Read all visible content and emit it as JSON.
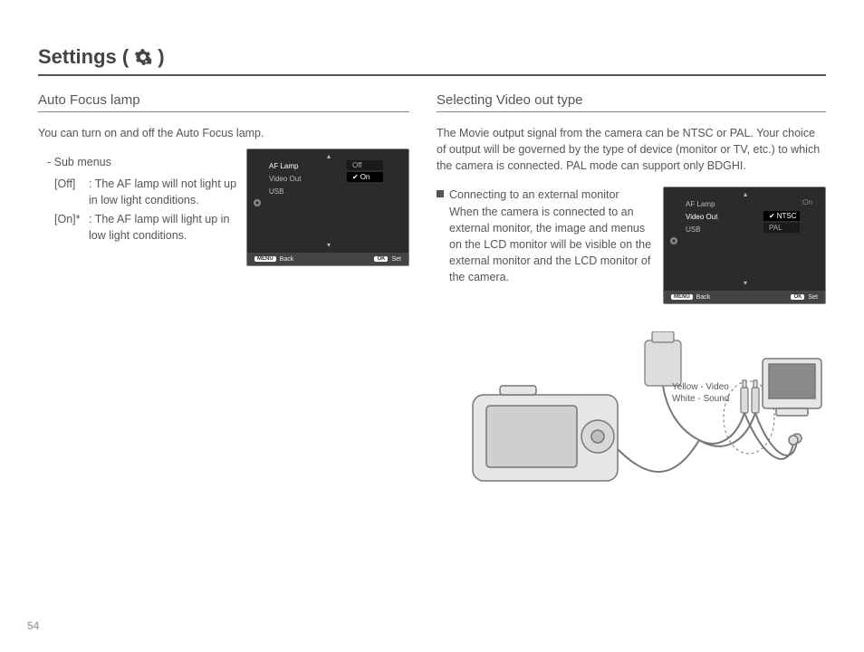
{
  "page": {
    "title_prefix": "Settings (",
    "title_suffix": ")",
    "number": "54"
  },
  "left": {
    "heading": "Auto Focus lamp",
    "intro": "You can turn on and off the Auto Focus lamp.",
    "sub_label": "- Sub menus",
    "items": [
      {
        "key": "[Off]",
        "desc": ": The AF lamp will not light up in low light conditions."
      },
      {
        "key": "[On]*",
        "desc": ": The AF lamp will light up in low light conditions."
      }
    ],
    "screen": {
      "menu": [
        "AF Lamp",
        "Video Out",
        "USB"
      ],
      "selected_menu": 0,
      "options": [
        "Off",
        "On"
      ],
      "selected_option": 1,
      "footer_back": "Back",
      "footer_set": "Set",
      "footer_back_btn": "MENU",
      "footer_set_btn": "OK"
    }
  },
  "right": {
    "heading": "Selecting Video out type",
    "intro": "The Movie output signal from the camera can be NTSC or PAL. Your choice of output will be governed by the type of device (monitor or TV, etc.) to which the camera is connected. PAL mode can support only BDGHI.",
    "bullet_title": "Connecting to an external monitor",
    "bullet_body": "When the camera is connected to an external monitor, the image and menus on the LCD monitor will be visible on the external monitor and the LCD monitor of the camera.",
    "screen": {
      "menu": [
        "AF Lamp",
        "Video Out",
        "USB"
      ],
      "selected_menu": 1,
      "right_val": ":On",
      "options": [
        "NTSC",
        "PAL"
      ],
      "selected_option": 0,
      "footer_back": "Back",
      "footer_set": "Set",
      "footer_back_btn": "MENU",
      "footer_set_btn": "OK"
    },
    "cable_label_1": "Yellow - Video",
    "cable_label_2": "White - Sound"
  }
}
